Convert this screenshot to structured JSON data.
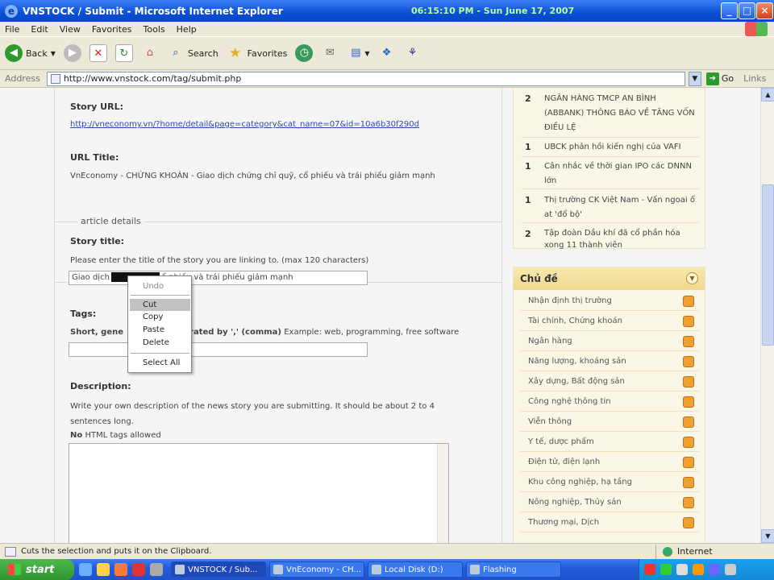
{
  "window": {
    "title": "VNSTOCK / Submit - Microsoft Internet Explorer",
    "clock": "06:15:10 PM - Sun June 17, 2007",
    "buttons": [
      "_",
      "□",
      "×"
    ]
  },
  "menu": [
    "File",
    "Edit",
    "View",
    "Favorites",
    "Tools",
    "Help"
  ],
  "toolbar": {
    "back_label": "Back",
    "search_label": "Search",
    "favorites_label": "Favorites"
  },
  "address": {
    "label": "Address",
    "url": "http://www.vnstock.com/tag/submit.php",
    "go_label": "Go",
    "links_label": "Links"
  },
  "form": {
    "story_url_label": "Story URL:",
    "story_url_value": "http://vneconomy.vn/?home/detail&page=category&cat_name=07&id=10a6b30f290d",
    "url_title_label": "URL Title:",
    "url_title_value": "VnEconomy - CHỨNG KHOÁN - Giao dịch chứng chỉ quỹ, cổ phiếu và trái phiếu giảm mạnh",
    "article_legend": "article details",
    "story_title_label": "Story title:",
    "story_title_hint": "Please enter the title of the story you are linking to. (max 120 characters)",
    "story_title_value_start": "Giao dịch",
    "story_title_value_end": "ổ phiếu và trái phiếu giảm mạnh",
    "tags_label": "Tags:",
    "tags_hint_bold": "Short, gene",
    "tags_hint_bold_end": "rated by ',' (comma)",
    "tags_hint_rest": "Example: web, programming, free software",
    "description_label": "Description:",
    "description_hint": "Write your own description of the news story you are submitting. It should be about 2 to 4 sentences long.",
    "no_html_bold": "No",
    "no_html_rest": "HTML tags allowed"
  },
  "context_menu": {
    "undo": "Undo",
    "cut": "Cut",
    "copy": "Copy",
    "paste": "Paste",
    "delete": "Delete",
    "select_all": "Select All"
  },
  "news_list": [
    {
      "rank": "2",
      "text": "NGÂN HÀNG TMCP AN BÌNH (ABBANK) THÔNG BÁO VỀ TĂNG VỐN ĐIỀU LỆ"
    },
    {
      "rank": "1",
      "text": "UBCK phản hồi kiến nghị của VAFI"
    },
    {
      "rank": "1",
      "text": "Cân nhắc về thời gian IPO các DNNN lớn"
    },
    {
      "rank": "1",
      "text": "Thị trường CK Việt Nam - Vấn ngoai ổ at 'đổ bộ'"
    },
    {
      "rank": "2",
      "text": "Tập đoàn Dầu khí đã cổ phần hóa xong 11 thành viên"
    }
  ],
  "topics": {
    "title": "Chủ đề",
    "items": [
      "Nhận định thị trường",
      "Tài chính, Chứng khoán",
      "Ngân hàng",
      "Năng lượng, khoáng sản",
      "Xây dựng, Bất động sản",
      "Công nghệ thông tin",
      "Viễn thông",
      "Y tế, dược phẩm",
      "Điện tử, điện lạnh",
      "Khu công nghiệp, hạ tầng",
      "Nông nghiệp, Thủy sản",
      "Thương mại, Dịch"
    ]
  },
  "status": {
    "text": "Cuts the selection and puts it on the Clipboard.",
    "zone": "Internet"
  },
  "taskbar": {
    "start_label": "start",
    "tasks": [
      "VNSTOCK / Sub...",
      "VnEconomy - CH...",
      "Local Disk (D:)",
      "Flashing"
    ]
  },
  "colors": {
    "title_bar": "#0a4fd6",
    "link": "#2a4aa8",
    "sidebar_bg": "#fbf7e6",
    "sidebar_header": "#efd98e",
    "rss_icon": "#f0a030",
    "taskbar": "#245ddb"
  }
}
